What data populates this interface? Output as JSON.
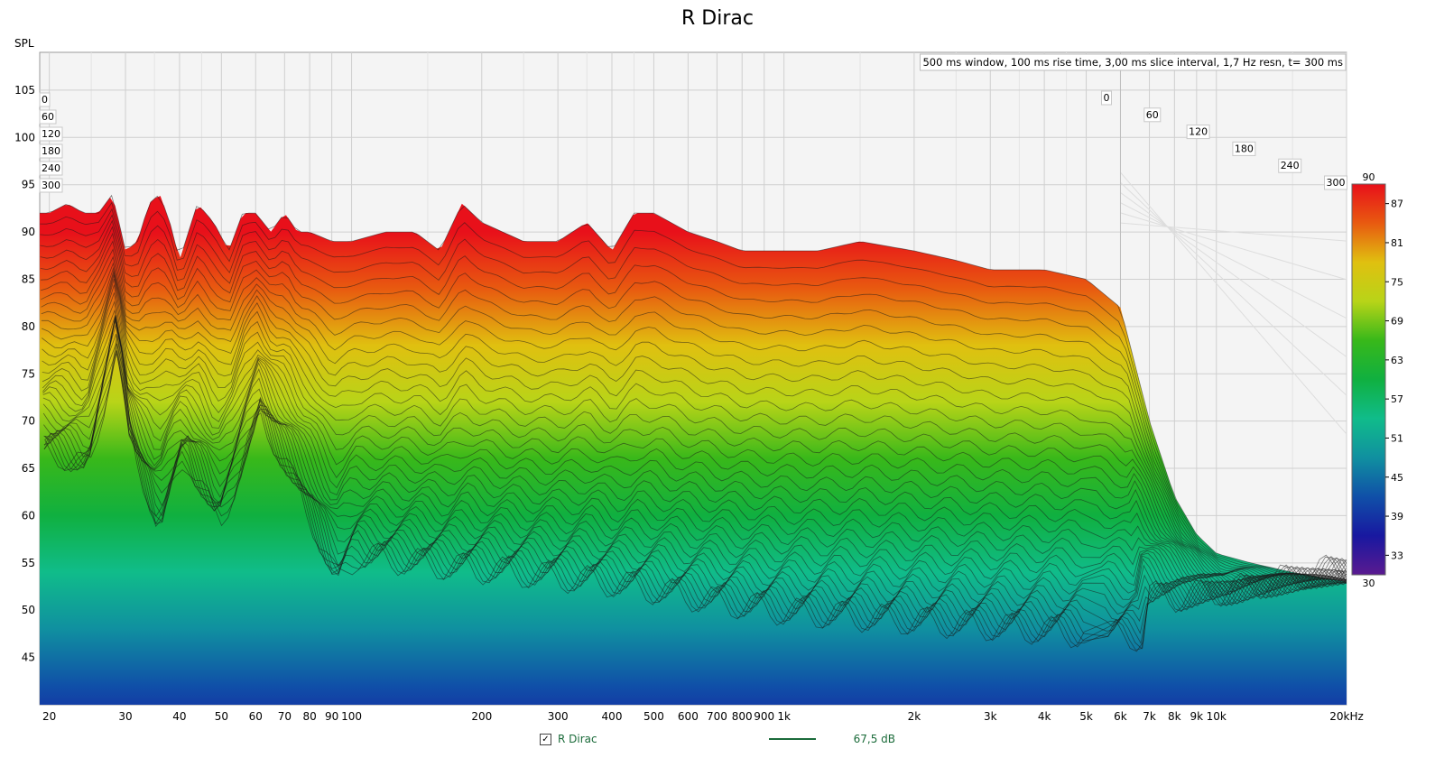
{
  "chart_data": {
    "type": "waterfall",
    "title": "R Dirac",
    "ylabel": "SPL",
    "annotation": "500 ms window, 100 ms rise time, 3,00 ms slice interval, 1,7 Hz resn, t= 300 ms",
    "x_scale": "log",
    "xlim": [
      19,
      20000
    ],
    "ylim": [
      40,
      109
    ],
    "x_ticks": [
      {
        "v": 20,
        "label": "20"
      },
      {
        "v": 30,
        "label": "30"
      },
      {
        "v": 40,
        "label": "40"
      },
      {
        "v": 50,
        "label": "50"
      },
      {
        "v": 60,
        "label": "60"
      },
      {
        "v": 70,
        "label": "70"
      },
      {
        "v": 80,
        "label": "80"
      },
      {
        "v": 90,
        "label": "90"
      },
      {
        "v": 100,
        "label": "100"
      },
      {
        "v": 200,
        "label": "200"
      },
      {
        "v": 300,
        "label": "300"
      },
      {
        "v": 400,
        "label": "400"
      },
      {
        "v": 500,
        "label": "500"
      },
      {
        "v": 600,
        "label": "600"
      },
      {
        "v": 700,
        "label": "700"
      },
      {
        "v": 800,
        "label": "800"
      },
      {
        "v": 900,
        "label": "900"
      },
      {
        "v": 1000,
        "label": "1k"
      },
      {
        "v": 2000,
        "label": "2k"
      },
      {
        "v": 3000,
        "label": "3k"
      },
      {
        "v": 4000,
        "label": "4k"
      },
      {
        "v": 5000,
        "label": "5k"
      },
      {
        "v": 6000,
        "label": "6k"
      },
      {
        "v": 7000,
        "label": "7k"
      },
      {
        "v": 8000,
        "label": "8k"
      },
      {
        "v": 9000,
        "label": "9k"
      },
      {
        "v": 10000,
        "label": "10k"
      },
      {
        "v": 20000,
        "label": "20kHz"
      }
    ],
    "y_ticks": [
      45,
      50,
      55,
      60,
      65,
      70,
      75,
      80,
      85,
      90,
      95,
      100,
      105
    ],
    "time_ticks_ms": [
      {
        "t": 0,
        "label": "0"
      },
      {
        "t": 60,
        "label": "60"
      },
      {
        "t": 120,
        "label": "120"
      },
      {
        "t": 180,
        "label": "180"
      },
      {
        "t": 240,
        "label": "240"
      },
      {
        "t": 300,
        "label": "300"
      }
    ],
    "colorbar": {
      "min": 30,
      "max": 90,
      "ticks": [
        "87",
        "81",
        "75",
        "69",
        "63",
        "57",
        "51",
        "45",
        "39",
        "33"
      ],
      "top_label": "90",
      "bottom_label": "30",
      "stops": [
        {
          "v": 90,
          "color": "#e8101a"
        },
        {
          "v": 84,
          "color": "#e85a10"
        },
        {
          "v": 78,
          "color": "#e0c010"
        },
        {
          "v": 72,
          "color": "#b8d418"
        },
        {
          "v": 66,
          "color": "#38b81a"
        },
        {
          "v": 60,
          "color": "#10b040"
        },
        {
          "v": 54,
          "color": "#10bc8a"
        },
        {
          "v": 48,
          "color": "#1090a0"
        },
        {
          "v": 42,
          "color": "#1050a8"
        },
        {
          "v": 36,
          "color": "#1818a0"
        },
        {
          "v": 30,
          "color": "#5a1a90"
        }
      ]
    },
    "slice_interval_ms": 3,
    "time_span_ms": 300,
    "front_slice_t0": {
      "freq_hz": [
        20,
        22,
        24,
        26,
        28,
        30,
        32,
        34,
        36,
        38,
        40,
        44,
        48,
        52,
        56,
        60,
        65,
        70,
        75,
        80,
        90,
        100,
        120,
        140,
        160,
        180,
        200,
        250,
        300,
        350,
        400,
        450,
        500,
        600,
        700,
        800,
        900,
        1000,
        1200,
        1500,
        2000,
        2500,
        3000,
        3500,
        4000,
        5000,
        6000,
        7000,
        8000,
        9000,
        10000,
        12000,
        15000,
        20000
      ],
      "spl_db": [
        92,
        93,
        92,
        92,
        94,
        88,
        89,
        93,
        94,
        91,
        87,
        93,
        91,
        88,
        92,
        92,
        90,
        92,
        90,
        90,
        89,
        89,
        90,
        90,
        88,
        93,
        91,
        89,
        89,
        91,
        88,
        92,
        92,
        90,
        89,
        88,
        88,
        88,
        88,
        89,
        88,
        87,
        86,
        86,
        86,
        85,
        82,
        70,
        62,
        58,
        56,
        55,
        54,
        53
      ]
    },
    "decay_min_db": [
      {
        "f": 20,
        "db": 66
      },
      {
        "f": 24,
        "db": 64
      },
      {
        "f": 28,
        "db": 78
      },
      {
        "f": 30,
        "db": 67
      },
      {
        "f": 35,
        "db": 58
      },
      {
        "f": 40,
        "db": 66
      },
      {
        "f": 48,
        "db": 58
      },
      {
        "f": 60,
        "db": 70
      },
      {
        "f": 80,
        "db": 58
      },
      {
        "f": 90,
        "db": 52
      },
      {
        "f": 100,
        "db": 55
      },
      {
        "f": 150,
        "db": 54
      },
      {
        "f": 250,
        "db": 53
      },
      {
        "f": 400,
        "db": 52
      },
      {
        "f": 700,
        "db": 50
      },
      {
        "f": 1000,
        "db": 49
      },
      {
        "f": 2000,
        "db": 48
      },
      {
        "f": 4000,
        "db": 47
      },
      {
        "f": 7000,
        "db": 46
      },
      {
        "f": 10000,
        "db": 47
      },
      {
        "f": 20000,
        "db": 50
      }
    ]
  },
  "legend": {
    "checkbox": "✓",
    "name": "R Dirac",
    "value": "67,5 dB"
  }
}
